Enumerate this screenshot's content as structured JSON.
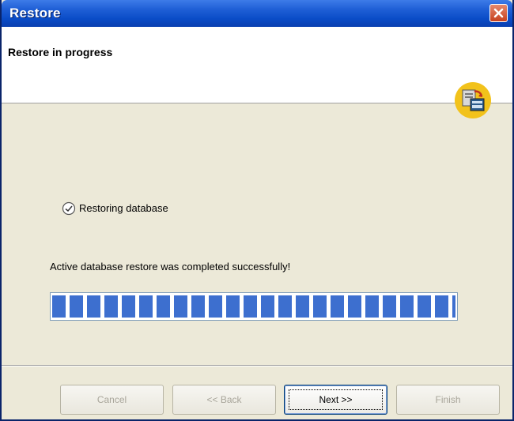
{
  "window": {
    "title": "Restore"
  },
  "header": {
    "title": "Restore in progress",
    "icon": "restore-archive-icon"
  },
  "status": {
    "icon": "check-circle-icon",
    "text": "Restoring database"
  },
  "message": "Active database restore was completed successfully!",
  "progress": {
    "value": 1.0,
    "color": "#3d6fcf"
  },
  "buttons": {
    "cancel": "Cancel",
    "back": "<< Back",
    "next": "Next >>",
    "finish": "Finish"
  },
  "colors": {
    "titlebar": "#0a4cc7",
    "dialog_bg": "#ece9d8",
    "close": "#c6411f"
  }
}
